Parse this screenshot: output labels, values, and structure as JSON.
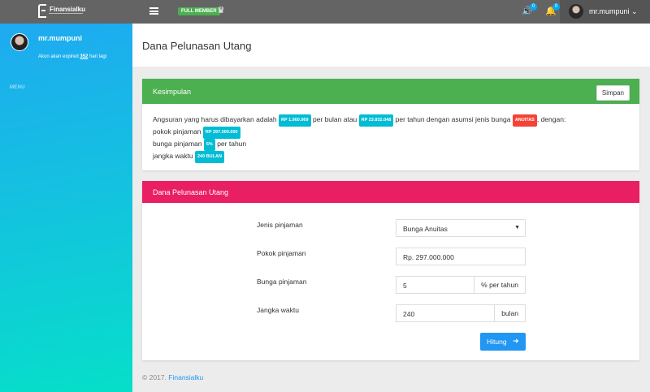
{
  "topbar": {
    "brand": "Finansialku",
    "member_badge": "FULL MEMBER",
    "crown_icon": "crown-icon",
    "notif_sound_count": "0",
    "notif_bell_count": "0",
    "user_name": "mr.mumpuni"
  },
  "sidebar": {
    "user_name": "mr.mumpuni",
    "expire_prefix": "Akun akan expired",
    "expire_days": "352",
    "expire_suffix": "hari lagi",
    "menu_label": "MENU"
  },
  "page": {
    "title": "Dana Pelunasan Utang"
  },
  "summary": {
    "title": "Kesimpulan",
    "save_label": "Simpan",
    "t1": "Angsuran yang harus dibayarkan adalah",
    "per_month": "RP 1.960.069",
    "t2": "per bulan atau",
    "per_year": "RP 23.832.048",
    "t3": "per tahun dengan asumsi jenis bunga",
    "interest_type": "ANUITAS",
    "t4": ", dengan:",
    "principal_label": "pokok pinjaman",
    "principal": "RP 297.000.000",
    "rate_label": "bunga pinjaman",
    "rate": "5%",
    "rate_suffix": "per tahun",
    "term_label": "jangka waktu",
    "term": "240 BULAN"
  },
  "form": {
    "title": "Dana Pelunasan Utang",
    "loan_type_label": "Jenis pinjaman",
    "loan_type_value": "Bunga Anuitas",
    "principal_label": "Pokok pinjaman",
    "principal_value": "Rp. 297.000.000",
    "rate_label": "Bunga pinjaman",
    "rate_value": "5",
    "rate_addon": "% per tahun",
    "term_label": "Jangka waktu",
    "term_value": "240",
    "term_addon": "bulan",
    "submit_label": "Hitung"
  },
  "footer": {
    "copyright": "© 2017.",
    "link": "Finansialku"
  },
  "colors": {
    "accent_green": "#4caf50",
    "accent_pink": "#e91e63",
    "accent_blue": "#2196f3",
    "tag_cyan": "#00bcd4",
    "tag_red": "#f44336"
  }
}
